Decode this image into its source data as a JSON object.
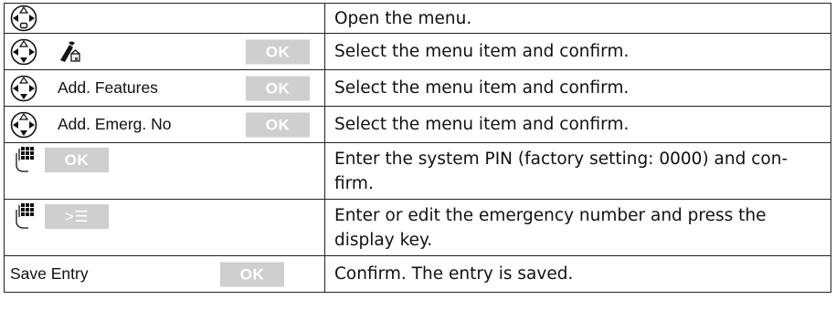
{
  "rows": [
    {
      "desc": "Open the menu."
    },
    {
      "ok": "OK",
      "desc": "Select the menu item and confirm."
    },
    {
      "label": "Add. Features",
      "ok": "OK",
      "desc": "Select the menu item and confirm."
    },
    {
      "label": "Add. Emerg. No",
      "ok": "OK",
      "desc": "Select the menu item and confirm."
    },
    {
      "ok": "OK",
      "desc": "Enter the system PIN (factory setting: 0000) and con-firm."
    },
    {
      "key": "˃☰",
      "desc": "Enter or edit the emergency number and press the display key."
    },
    {
      "label": "Save Entry",
      "ok": "OK",
      "desc": "Confirm. The entry is saved."
    }
  ],
  "icons": {
    "nav": "navigation-key-icon",
    "keypad": "keypad-hand-icon",
    "settings": "settings-tools-icon"
  },
  "colors": {
    "button_bg": "#cfcfcf",
    "button_text": "#ffffff",
    "border": "#222222"
  }
}
